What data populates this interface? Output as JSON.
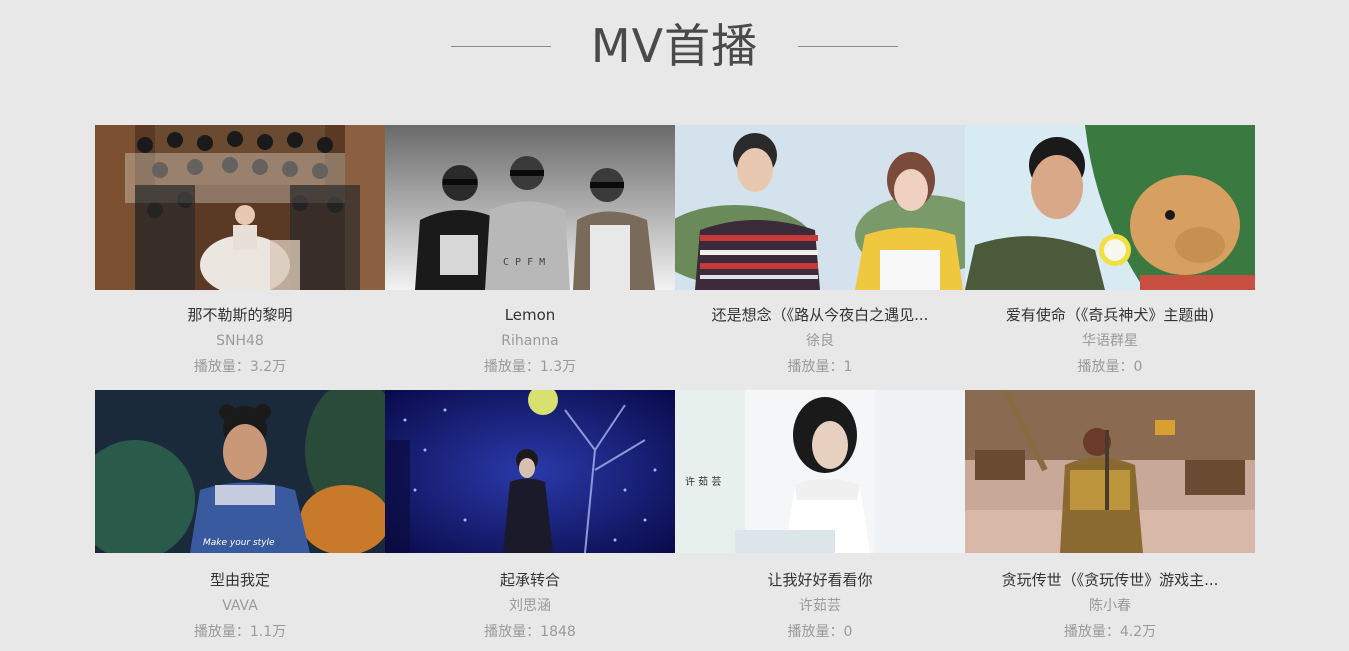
{
  "section": {
    "title": "MV首播"
  },
  "mvs": [
    {
      "title": "那不勒斯的黎明",
      "artist": "SNH48",
      "plays": "播放量：3.2万",
      "thumb_colors": [
        "#5a3a24",
        "#c8a070",
        "#e8e0d8"
      ]
    },
    {
      "title": "Lemon",
      "artist": "Rihanna",
      "plays": "播放量：1.3万",
      "thumb_colors": [
        "#f0f0f0",
        "#8a8a8a",
        "#2a2a2a"
      ]
    },
    {
      "title": "还是想念（《路从今夜白之遇见...",
      "artist": "徐良",
      "plays": "播放量：1",
      "thumb_colors": [
        "#c8d8e8",
        "#6a8a5a",
        "#f0c840"
      ]
    },
    {
      "title": "爱有使命（《奇兵神犬》主题曲)",
      "artist": "华语群星",
      "plays": "播放量：0",
      "thumb_colors": [
        "#d0e8f0",
        "#3a7a40",
        "#d8a060"
      ]
    },
    {
      "title": "型由我定",
      "artist": "VAVA",
      "plays": "播放量：1.1万",
      "thumb_colors": [
        "#1a2a3a",
        "#2a5a4a",
        "#3a5aa0"
      ],
      "caption": "Make your style"
    },
    {
      "title": "起承转合",
      "artist": "刘思涵",
      "plays": "播放量：1848",
      "thumb_colors": [
        "#1a1a6a",
        "#2a3aaa",
        "#d8e070"
      ]
    },
    {
      "title": "让我好好看看你",
      "artist": "许茹芸",
      "plays": "播放量：0",
      "thumb_colors": [
        "#f4f6f8",
        "#e8eef2",
        "#1a1a1a"
      ],
      "caption": "许 茹 芸"
    },
    {
      "title": "贪玩传世（《贪玩传世》游戏主...",
      "artist": "陈小春",
      "plays": "播放量：4.2万",
      "thumb_colors": [
        "#c8a898",
        "#8a6a50",
        "#6a4a30"
      ]
    }
  ]
}
